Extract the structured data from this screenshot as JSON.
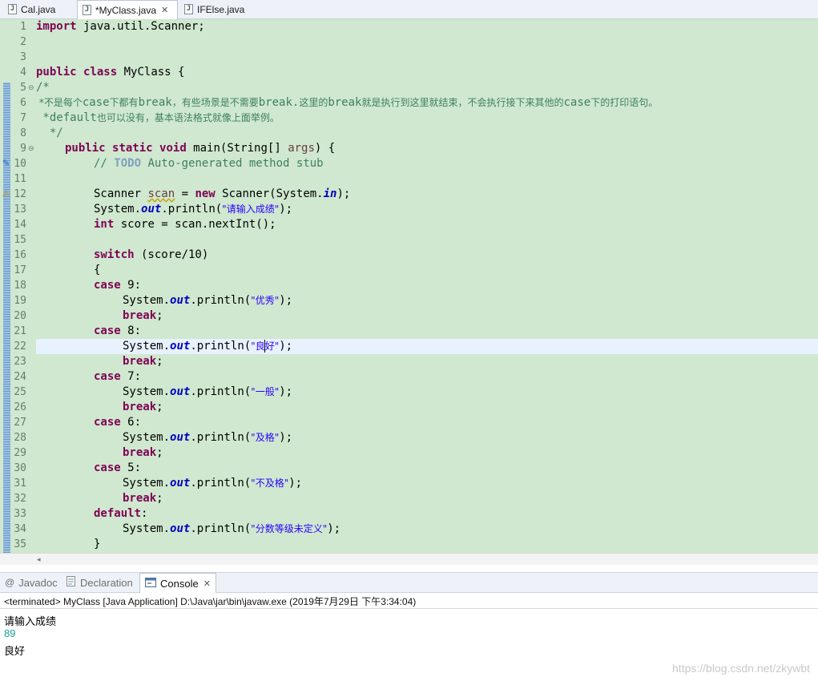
{
  "editor_tabs": [
    {
      "label": "Cal.java",
      "active": false
    },
    {
      "label": "*MyClass.java",
      "active": true,
      "close": "✕"
    },
    {
      "label": "IFElse.java",
      "active": false
    }
  ],
  "line_numbers": [
    "1",
    "2",
    "3",
    "4",
    "5",
    "6",
    "7",
    "8",
    "9",
    "10",
    "11",
    "12",
    "13",
    "14",
    "15",
    "16",
    "17",
    "18",
    "19",
    "20",
    "21",
    "22",
    "23",
    "24",
    "25",
    "26",
    "27",
    "28",
    "29",
    "30",
    "31",
    "32",
    "33",
    "34",
    "35"
  ],
  "code": {
    "l1_kw": "import",
    "l1_rest": " java.util.Scanner;",
    "l4_kw1": "public",
    "l4_kw2": "class",
    "l4_rest": " MyClass {",
    "l5": "/*",
    "l6_a": " *不是每个",
    "l6_b": "case",
    "l6_c": "下都有",
    "l6_d": "break",
    "l6_e": "，有些场景是不需要",
    "l6_f": "break.",
    "l6_g": "这里的",
    "l6_h": "break",
    "l6_i": "就是执行到这里就结束，不会执行接下来其他的",
    "l6_j": "case",
    "l6_k": "下的打印语句。",
    "l7_a": " *default",
    "l7_b": "也可以没有，基本语法格式就像上面举例。",
    "l8": "  */",
    "l9_kw1": "public",
    "l9_kw2": "static",
    "l9_kw3": "void",
    "l9_a": " main(String[] ",
    "l9_var": "args",
    "l9_b": ") {",
    "l10_a": "// ",
    "l10_todo": "TODO",
    "l10_b": " Auto-generated method stub",
    "l12_a": "Scanner ",
    "l12_var": "scan",
    "l12_b": " = ",
    "l12_kw": "new",
    "l12_c": " Scanner(System.",
    "l12_fld": "in",
    "l12_d": ");",
    "sys": "System.",
    "out": "out",
    "println": ".println(",
    "end": ");",
    "l13_str": "\"请输入成绩\"",
    "l14_kw": "int",
    "l14_rest": " score = scan.nextInt();",
    "l16_kw": "switch",
    "l16_rest": " (score/10)",
    "l17": "{",
    "case": "case",
    "break": "break",
    "semi": ";",
    "l18_rest": " 9:",
    "l19_str": "\"优秀\"",
    "l21_rest": " 8:",
    "l22_str_a": "\"良",
    "l22_str_b": "好\"",
    "l24_rest": " 7:",
    "l25_str": "\"一般\"",
    "l27_rest": " 6:",
    "l28_str": "\"及格\"",
    "l30_rest": " 5:",
    "l31_str": "\"不及格\"",
    "l33_kw": "default",
    "l33_rest": ":",
    "l34_str": "\"分数等级未定义\"",
    "l35": "}"
  },
  "view_tabs": [
    {
      "label": "Javadoc",
      "icon": "@",
      "active": false
    },
    {
      "label": "Declaration",
      "icon": "declaration-icon",
      "active": false
    },
    {
      "label": "Console",
      "icon": "console-icon",
      "active": true,
      "close": "✕"
    }
  ],
  "console": {
    "header": "<terminated> MyClass [Java Application] D:\\Java\\jar\\bin\\javaw.exe (2019年7月29日 下午3:34:04)",
    "output_line1": "请输入成绩",
    "input_line": "89",
    "output_line2": "良好",
    "input_color": "#1aa39a"
  },
  "watermark": "https://blog.csdn.net/zkywbt",
  "colors": {
    "editor_bg": "#cfe8cf",
    "keyword": "#7f0055",
    "string": "#2a00ff",
    "comment": "#3f7f5f",
    "current_line": "#e8f2fe"
  }
}
